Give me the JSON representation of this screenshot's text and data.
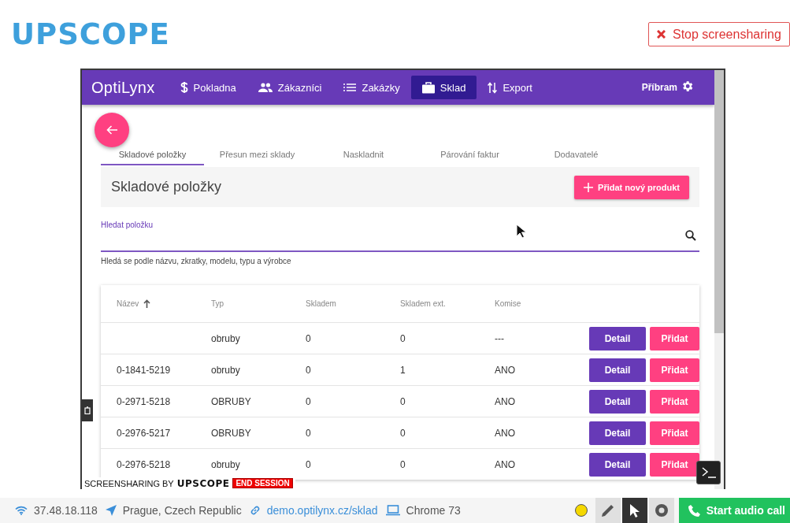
{
  "header": {
    "logo": "UPSCOPE",
    "stop_button": "Stop screensharing"
  },
  "app": {
    "brand": "OptiLynx",
    "location": "Příbram",
    "nav": [
      {
        "label": "Pokladna",
        "selected": false
      },
      {
        "label": "Zákazníci",
        "selected": false
      },
      {
        "label": "Zakázky",
        "selected": false
      },
      {
        "label": "Sklad",
        "selected": true
      },
      {
        "label": "Export",
        "selected": false
      }
    ]
  },
  "tabs": [
    {
      "label": "Skladové položky",
      "selected": true
    },
    {
      "label": "Přesun mezi sklady",
      "selected": false
    },
    {
      "label": "Naskladnit",
      "selected": false
    },
    {
      "label": "Párování faktur",
      "selected": false
    },
    {
      "label": "Dodavatelé",
      "selected": false
    }
  ],
  "panel": {
    "title": "Skladové položky",
    "add_button": "Přidat nový produkt"
  },
  "search": {
    "label": "Hledat položku",
    "hint": "Hledá se podle názvu, zkratky, modelu, typu a výrobce"
  },
  "table": {
    "columns": [
      {
        "label": "Název",
        "sorted": true
      },
      {
        "label": "Typ",
        "sorted": false
      },
      {
        "label": "Skladem",
        "sorted": false
      },
      {
        "label": "Skladem ext.",
        "sorted": false
      },
      {
        "label": "Komise",
        "sorted": false
      }
    ],
    "rows": [
      {
        "cells": [
          "",
          "obruby",
          "0",
          "0",
          "---"
        ],
        "actions": [
          "Detail",
          "Přidat"
        ]
      },
      {
        "cells": [
          "0-1841-5219",
          "obruby",
          "0",
          "1",
          "ANO"
        ],
        "actions": [
          "Detail",
          "Přidat"
        ]
      },
      {
        "cells": [
          "0-2971-5218",
          "OBRUBY",
          "0",
          "0",
          "ANO"
        ],
        "actions": [
          "Detail",
          "Přidat"
        ]
      },
      {
        "cells": [
          "0-2976-5217",
          "OBRUBY",
          "0",
          "0",
          "ANO"
        ],
        "actions": [
          "Detail",
          "Přidat"
        ]
      },
      {
        "cells": [
          "0-2976-5218",
          "obruby",
          "0",
          "0",
          "ANO"
        ],
        "actions": [
          "Detail",
          "Přidat"
        ]
      }
    ]
  },
  "overlay": {
    "banner": "SCREENSHARING BY",
    "banner_logo": "UPSCOPE",
    "end_button": "END SESSION"
  },
  "status_bar": {
    "ip": "37.48.18.118",
    "location": "Prague, Czech Republic",
    "url": "demo.optilynx.cz/sklad",
    "browser": "Chrome 73",
    "tools": [
      {
        "kind": "color",
        "color": "#f5d800",
        "selected": false
      },
      {
        "kind": "pencil",
        "selected": false
      },
      {
        "kind": "pointer",
        "selected": true
      },
      {
        "kind": "record",
        "selected": false
      }
    ],
    "audio_button": "Start audio call"
  }
}
